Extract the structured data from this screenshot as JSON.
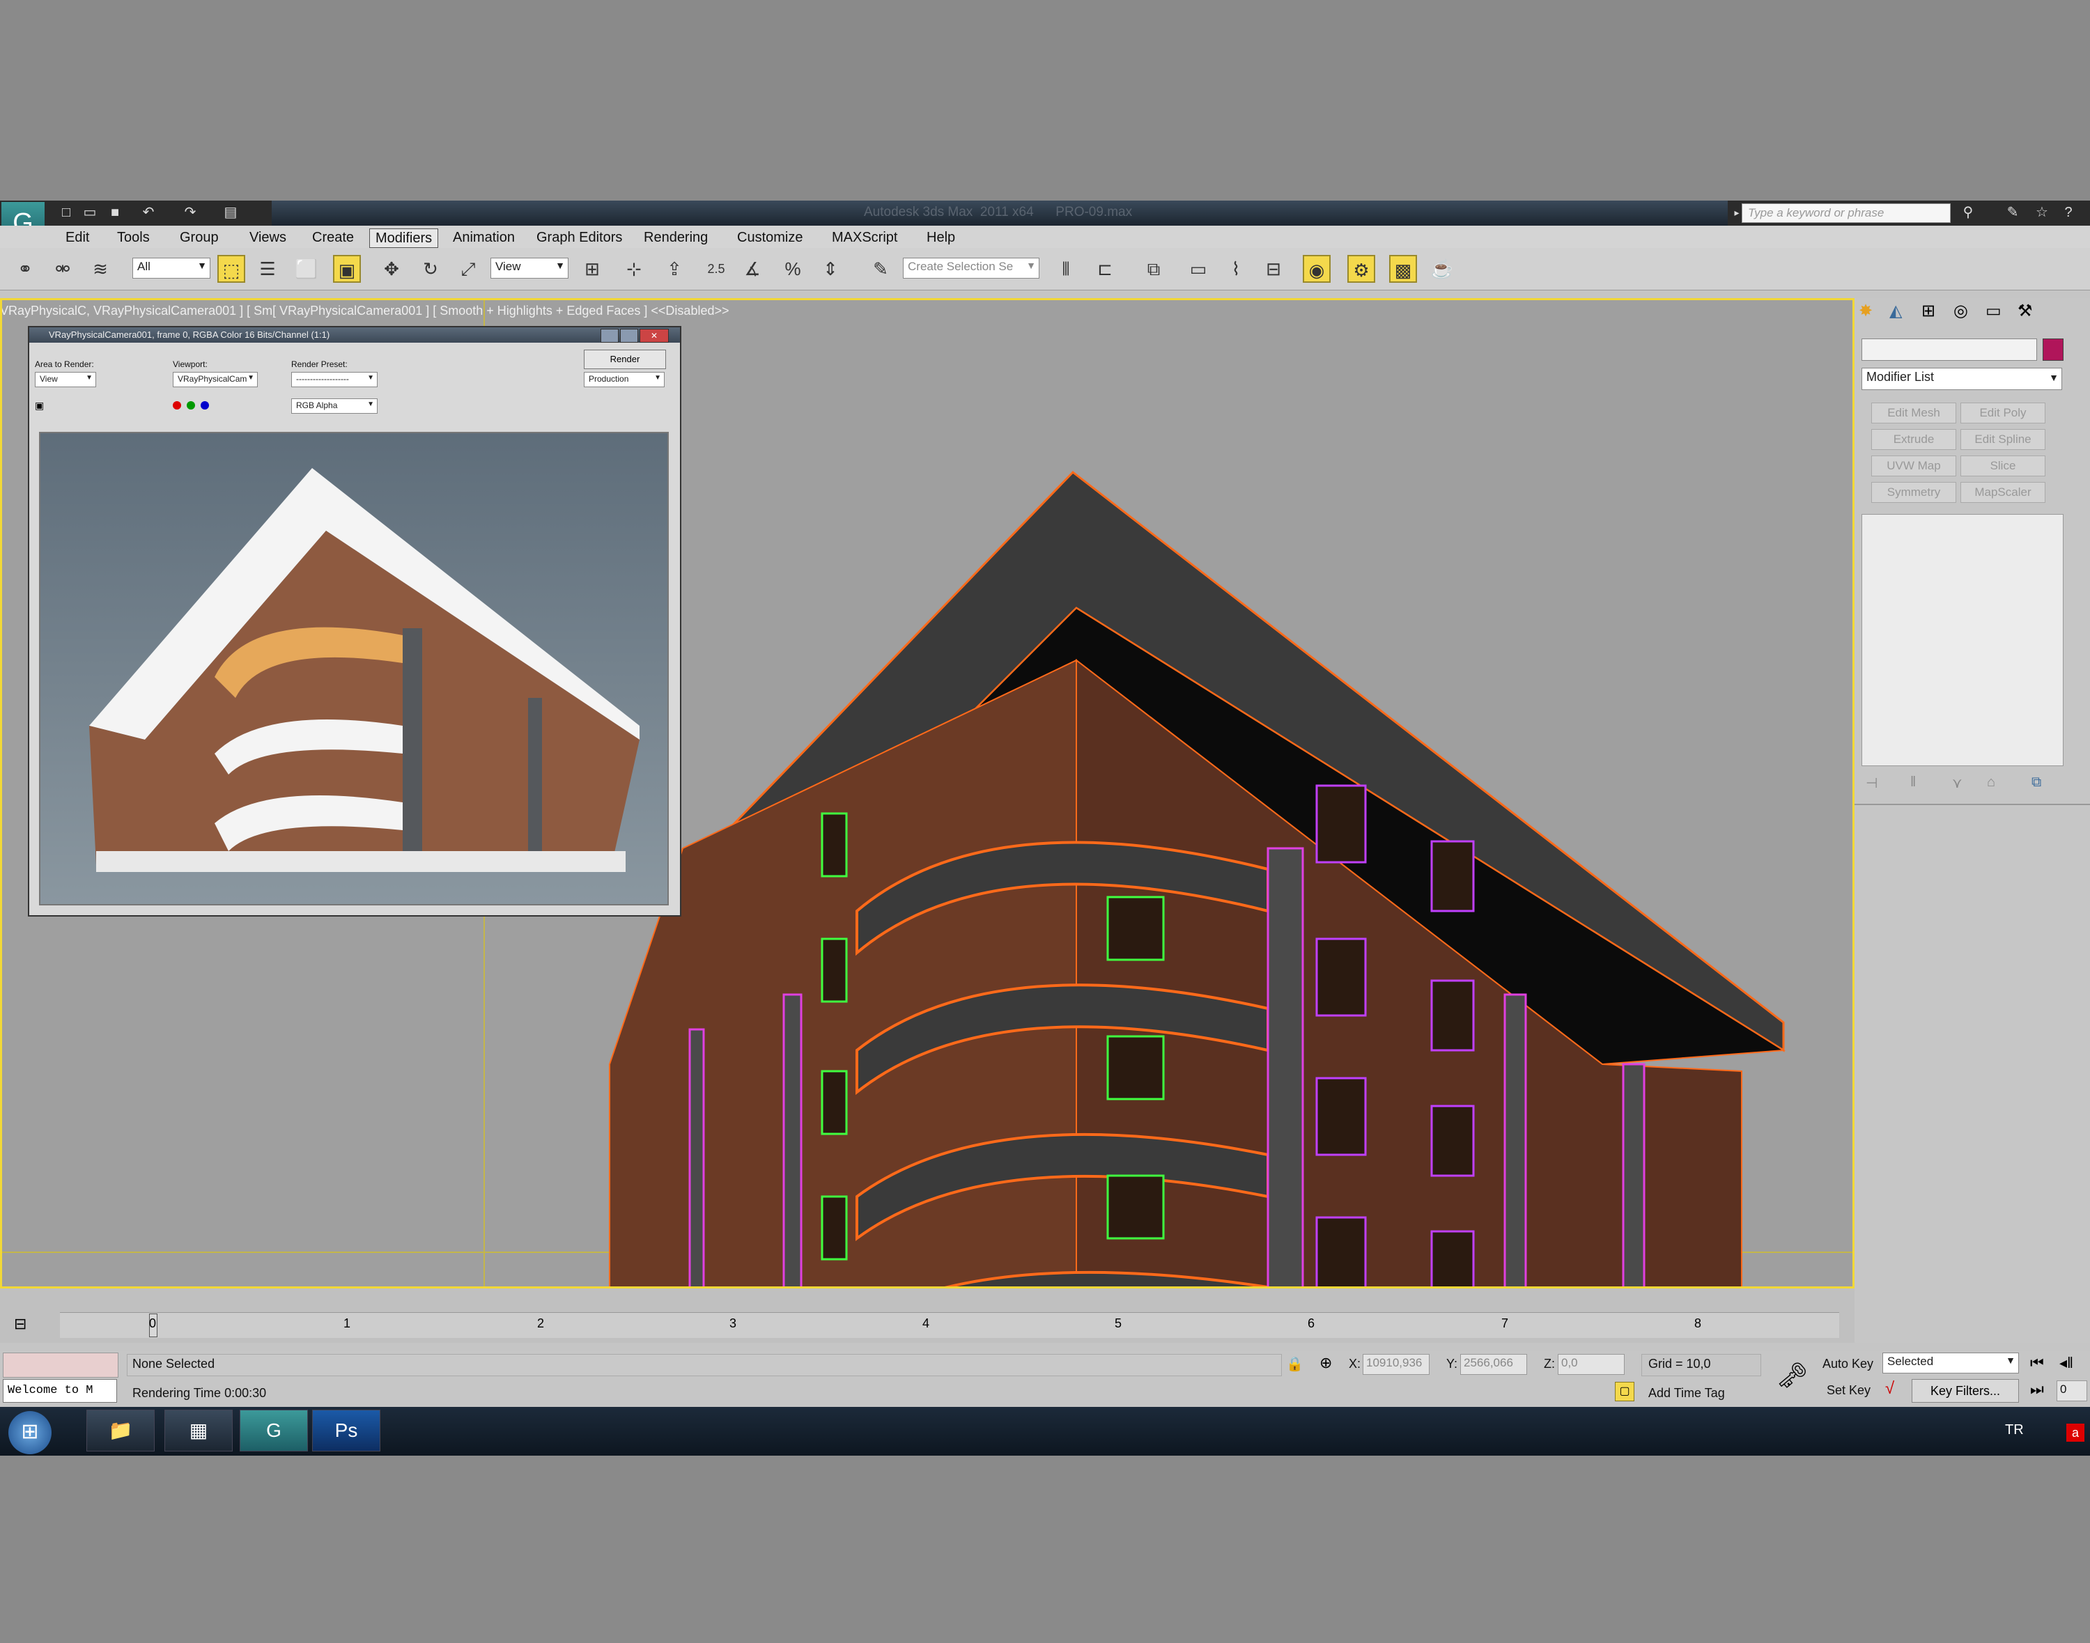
{
  "window": {
    "title": "Autodesk 3ds Max  2011 x64      PRO-09.max",
    "logo_icon": "3dsmax-logo-icon"
  },
  "quick_access": [
    "new-icon",
    "open-icon",
    "save-icon",
    "undo-icon",
    "redo-icon",
    "project-icon"
  ],
  "search": {
    "placeholder": "Type a keyword or phrase"
  },
  "menu": [
    "Edit",
    "Tools",
    "Group",
    "Views",
    "Create",
    "Modifiers",
    "Animation",
    "Graph Editors",
    "Rendering",
    "Customize",
    "MAXScript",
    "Help"
  ],
  "menu_selected": "Modifiers",
  "toolbar": {
    "filter": "All",
    "ref_coord": "View",
    "snap_value": "2.5",
    "selection_set": "Create Selection Se"
  },
  "viewport": {
    "label": "VRayPhysicalC, VRayPhysicalCamera001 ] [ Sm[ VRayPhysicalCamera001 ] [ Smooth + Highlights + Edged Faces ] <<Disabled>>",
    "border_color": "#f2d836"
  },
  "frame_buffer": {
    "title": "VRayPhysicalCamera001, frame 0, RGBA Color 16 Bits/Channel (1:1)",
    "area_label": "Area to Render:",
    "area_value": "View",
    "viewport_label": "Viewport:",
    "viewport_value": "VRayPhysicalCam",
    "preset_label": "Render Preset:",
    "preset_value": "-------------------",
    "render_button": "Render",
    "production_value": "Production",
    "channel_value": "RGB Alpha"
  },
  "command_panel": {
    "modifier_list": "Modifier List",
    "swatch_color": "#b0155a",
    "buttons": [
      "Edit Mesh",
      "Edit Poly",
      "Extrude",
      "Edit Spline",
      "UVW Map",
      "Slice",
      "Symmetry",
      "MapScaler"
    ]
  },
  "timeline": {
    "ticks": [
      "0",
      "1",
      "2",
      "3",
      "4",
      "5",
      "6",
      "7",
      "8"
    ],
    "current_frame": 0
  },
  "status": {
    "maxscript": "Welcome to M",
    "selection": "None Selected",
    "prompt": "Rendering Time  0:00:30",
    "x_label": "X:",
    "x_value": "10910,936",
    "y_label": "Y:",
    "y_value": "2566,066",
    "z_label": "Z:",
    "z_value": "0,0",
    "grid": "Grid = 10,0",
    "time_tag": "Add Time Tag",
    "auto_key": "Auto Key",
    "set_key": "Set Key",
    "selected_value": "Selected",
    "key_filters": "Key Filters...",
    "frame_value": "0"
  },
  "taskbar": {
    "lang": "TR",
    "apps": [
      "windows-explorer-icon",
      "task-switcher-icon",
      "3dsmax-taskbar-icon",
      "photoshop-icon"
    ],
    "ps_text": "Ps"
  }
}
